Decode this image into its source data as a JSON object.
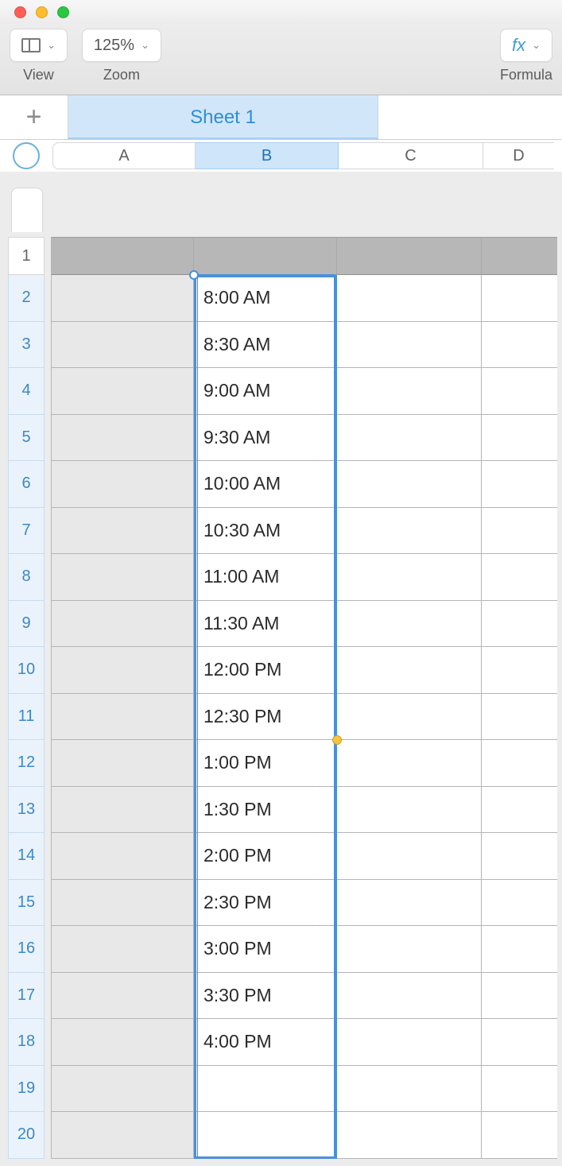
{
  "toolbar": {
    "view_label": "View",
    "zoom_value": "125%",
    "zoom_label": "Zoom",
    "formula_label": "Formula",
    "fx_text": "fx"
  },
  "sheet_tab": "Sheet 1",
  "columns": [
    "A",
    "B",
    "C",
    "D"
  ],
  "rows": [
    "1",
    "2",
    "3",
    "4",
    "5",
    "6",
    "7",
    "8",
    "9",
    "10",
    "11",
    "12",
    "13",
    "14",
    "15",
    "16",
    "17",
    "18",
    "19",
    "20"
  ],
  "cells": {
    "B": {
      "2": "8:00 AM",
      "3": "8:30 AM",
      "4": "9:00 AM",
      "5": "9:30 AM",
      "6": "10:00 AM",
      "7": "10:30 AM",
      "8": "11:00 AM",
      "9": "11:30 AM",
      "10": "12:00 PM",
      "11": "12:30 PM",
      "12": "1:00 PM",
      "13": "1:30 PM",
      "14": "2:00 PM",
      "15": "2:30 PM",
      "16": "3:00 PM",
      "17": "3:30 PM",
      "18": "4:00 PM"
    }
  },
  "selected_column": "B"
}
